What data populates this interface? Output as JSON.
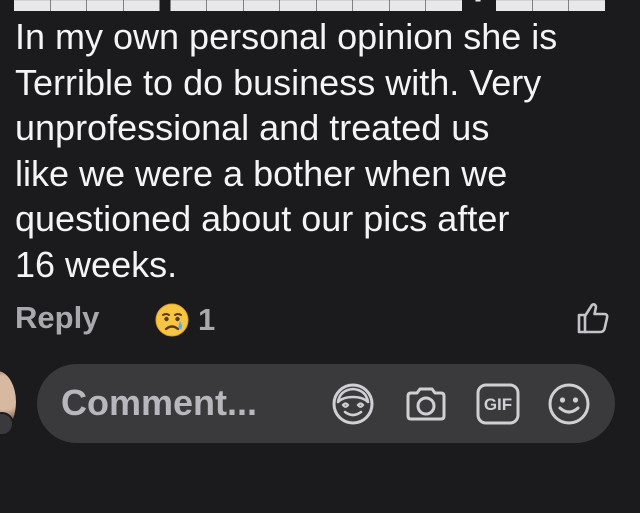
{
  "comment": {
    "body_lines": [
      "In my own personal opinion she is",
      "Terrible to do business with. Very",
      "unprofessional and treated us",
      "like we were a bother when we",
      "questioned about our pics after",
      "16 weeks."
    ],
    "reply_label": "Reply",
    "reaction": {
      "icon": "crying-face-emoji",
      "count": "1"
    },
    "like_icon": "thumbs-up-outline-icon"
  },
  "composer": {
    "placeholder": "Comment...",
    "icons": [
      "avatar-sticker-icon",
      "camera-icon",
      "gif-icon",
      "smiley-icon"
    ],
    "gif_text": "GIF"
  },
  "colors": {
    "background": "#1b1b1d",
    "text": "#f4f4f6",
    "muted": "#a9a9ad",
    "composer_bg": "#3a3a3d"
  }
}
